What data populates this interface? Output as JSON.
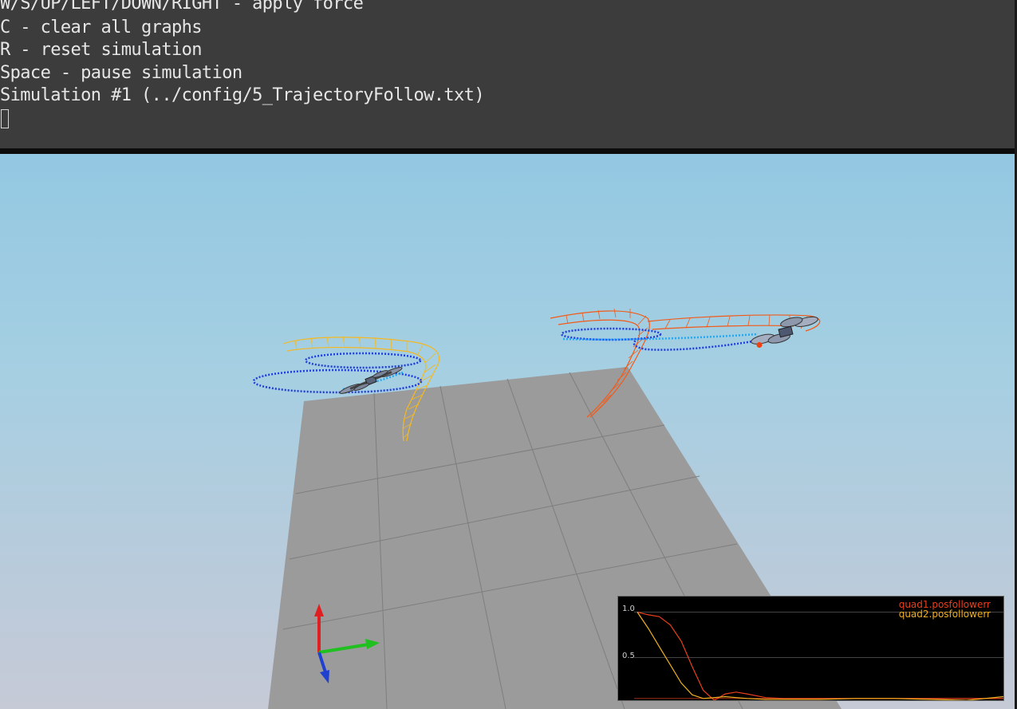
{
  "terminal": {
    "lines": [
      "W/S/UP/LEFT/DOWN/RIGHT - apply force",
      "C - clear all graphs",
      "R - reset simulation",
      "Space - pause simulation",
      "Simulation #1 (../config/5_TrajectoryFollow.txt)"
    ]
  },
  "graph": {
    "y_ticks": [
      "1.0",
      "0.5"
    ],
    "series": [
      {
        "name": "quad1.posfollowerr",
        "color": "#e8401c"
      },
      {
        "name": "quad2.posfollowerr",
        "color": "#f0b020"
      }
    ]
  },
  "chart_data": {
    "type": "line",
    "title": "",
    "xlabel": "",
    "ylabel": "",
    "ylim": [
      0,
      1.1
    ],
    "x": [
      0.0,
      0.03,
      0.06,
      0.09,
      0.12,
      0.15,
      0.18,
      0.21,
      0.24,
      0.27,
      0.3,
      0.35,
      0.4,
      0.5,
      0.6,
      0.7,
      0.8,
      0.9,
      1.0
    ],
    "series": [
      {
        "name": "quad1.posfollowerr",
        "values": [
          1.0,
          0.97,
          0.95,
          0.86,
          0.68,
          0.4,
          0.14,
          0.03,
          0.1,
          0.12,
          0.1,
          0.06,
          0.05,
          0.05,
          0.05,
          0.05,
          0.05,
          0.05,
          0.05
        ]
      },
      {
        "name": "quad2.posfollowerr",
        "values": [
          1.0,
          0.82,
          0.62,
          0.42,
          0.22,
          0.09,
          0.05,
          0.06,
          0.07,
          0.06,
          0.05,
          0.04,
          0.04,
          0.04,
          0.05,
          0.05,
          0.04,
          0.03,
          0.07
        ]
      }
    ],
    "reference_line": 0.05,
    "grid": true,
    "legend": "top-right"
  },
  "colors": {
    "terminal_bg": "#3c3c3c",
    "terminal_text": "#e6e6e6",
    "floor": "#9b9b9b",
    "trajectory_blue": "#1e3ce0",
    "trajectory_cyan": "#22a8f0",
    "ribbon_orange": "#f25a18",
    "ribbon_yellow": "#f5b820",
    "axis_x": "#20c020",
    "axis_y": "#e02020",
    "axis_z": "#2040d0"
  },
  "icons": [
    "xyz-axis-gizmo-icon",
    "quadcopter-icon"
  ]
}
